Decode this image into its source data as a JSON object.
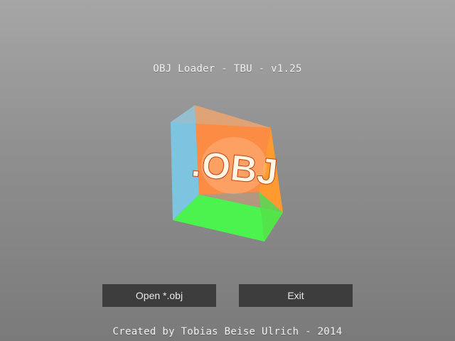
{
  "app": {
    "title": "OBJ Loader - TBU - v1.25"
  },
  "logo": {
    "text": ".OBJ",
    "colors": {
      "left_face": "#77c6e6",
      "back_face": "#ff8a3d",
      "right_face": "#ffa03a",
      "bottom_face": "#4cf04c",
      "top_face": "#9fb7c4"
    }
  },
  "buttons": {
    "open_label": "Open *.obj",
    "exit_label": "Exit"
  },
  "footer": {
    "credits": "Created by Tobias Beise Ulrich - 2014"
  }
}
